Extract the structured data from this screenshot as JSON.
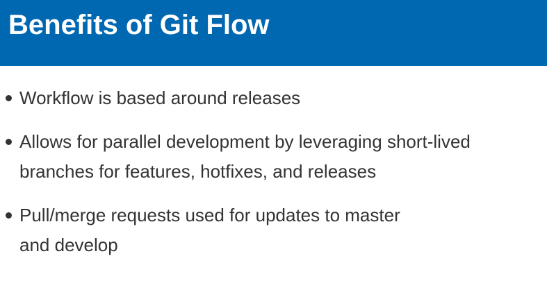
{
  "slide": {
    "title": "Benefits of Git Flow",
    "bullets": [
      {
        "lines": [
          "Workflow is based around releases"
        ]
      },
      {
        "lines": [
          "Allows for parallel development by leveraging short-lived",
          "branches for features, hotfixes, and releases"
        ]
      },
      {
        "lines": [
          "Pull/merge requests used for updates to master",
          "and develop"
        ]
      }
    ]
  },
  "colors": {
    "header_background": "#0067b1",
    "title_text": "#ffffff",
    "body_text": "#333333",
    "page_background": "#ffffff"
  }
}
